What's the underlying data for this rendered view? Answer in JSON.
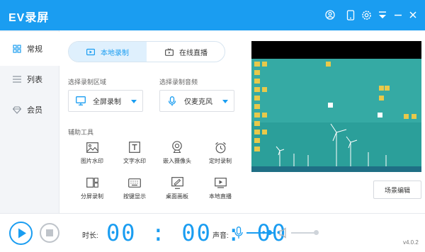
{
  "app": {
    "title": "EV录屏",
    "version": "v4.0.2"
  },
  "titlebar": {
    "icons": [
      "user-icon",
      "phone-icon",
      "settings-icon",
      "menu-icon",
      "minimize-icon",
      "close-icon"
    ]
  },
  "sidebar": {
    "items": [
      {
        "label": "常规",
        "icon": "grid-icon",
        "active": true
      },
      {
        "label": "列表",
        "icon": "list-icon",
        "active": false
      },
      {
        "label": "会员",
        "icon": "diamond-icon",
        "active": false
      }
    ]
  },
  "tabs": [
    {
      "label": "本地录制",
      "icon": "video-icon",
      "active": true
    },
    {
      "label": "在线直播",
      "icon": "tv-icon",
      "active": false
    }
  ],
  "record_area": {
    "label": "选择录制区域",
    "value": "全屏录制",
    "icon": "monitor-icon"
  },
  "record_audio": {
    "label": "选择录制音频",
    "value": "仅麦克风",
    "icon": "microphone-icon"
  },
  "tools": {
    "label": "辅助工具",
    "items": [
      {
        "label": "图片水印",
        "icon": "image-icon"
      },
      {
        "label": "文字水印",
        "icon": "text-icon"
      },
      {
        "label": "嵌入摄像头",
        "icon": "webcam-icon"
      },
      {
        "label": "定时录制",
        "icon": "alarm-clock-icon"
      },
      {
        "label": "分屏录制",
        "icon": "split-screen-icon"
      },
      {
        "label": "按键显示",
        "icon": "keyboard-icon"
      },
      {
        "label": "桌面画板",
        "icon": "drawing-board-icon"
      },
      {
        "label": "本地直播",
        "icon": "live-icon"
      }
    ]
  },
  "scene_button": "场景编辑",
  "bottom": {
    "duration_label": "时长:",
    "timer": "00:00:00",
    "volume_label": "声音:",
    "mic_level": 0.8,
    "speaker_level": 1.0
  },
  "colors": {
    "accent": "#1a9df1",
    "desktop": "#32a9a3",
    "sidebar_bg": "#f3f5f8"
  }
}
